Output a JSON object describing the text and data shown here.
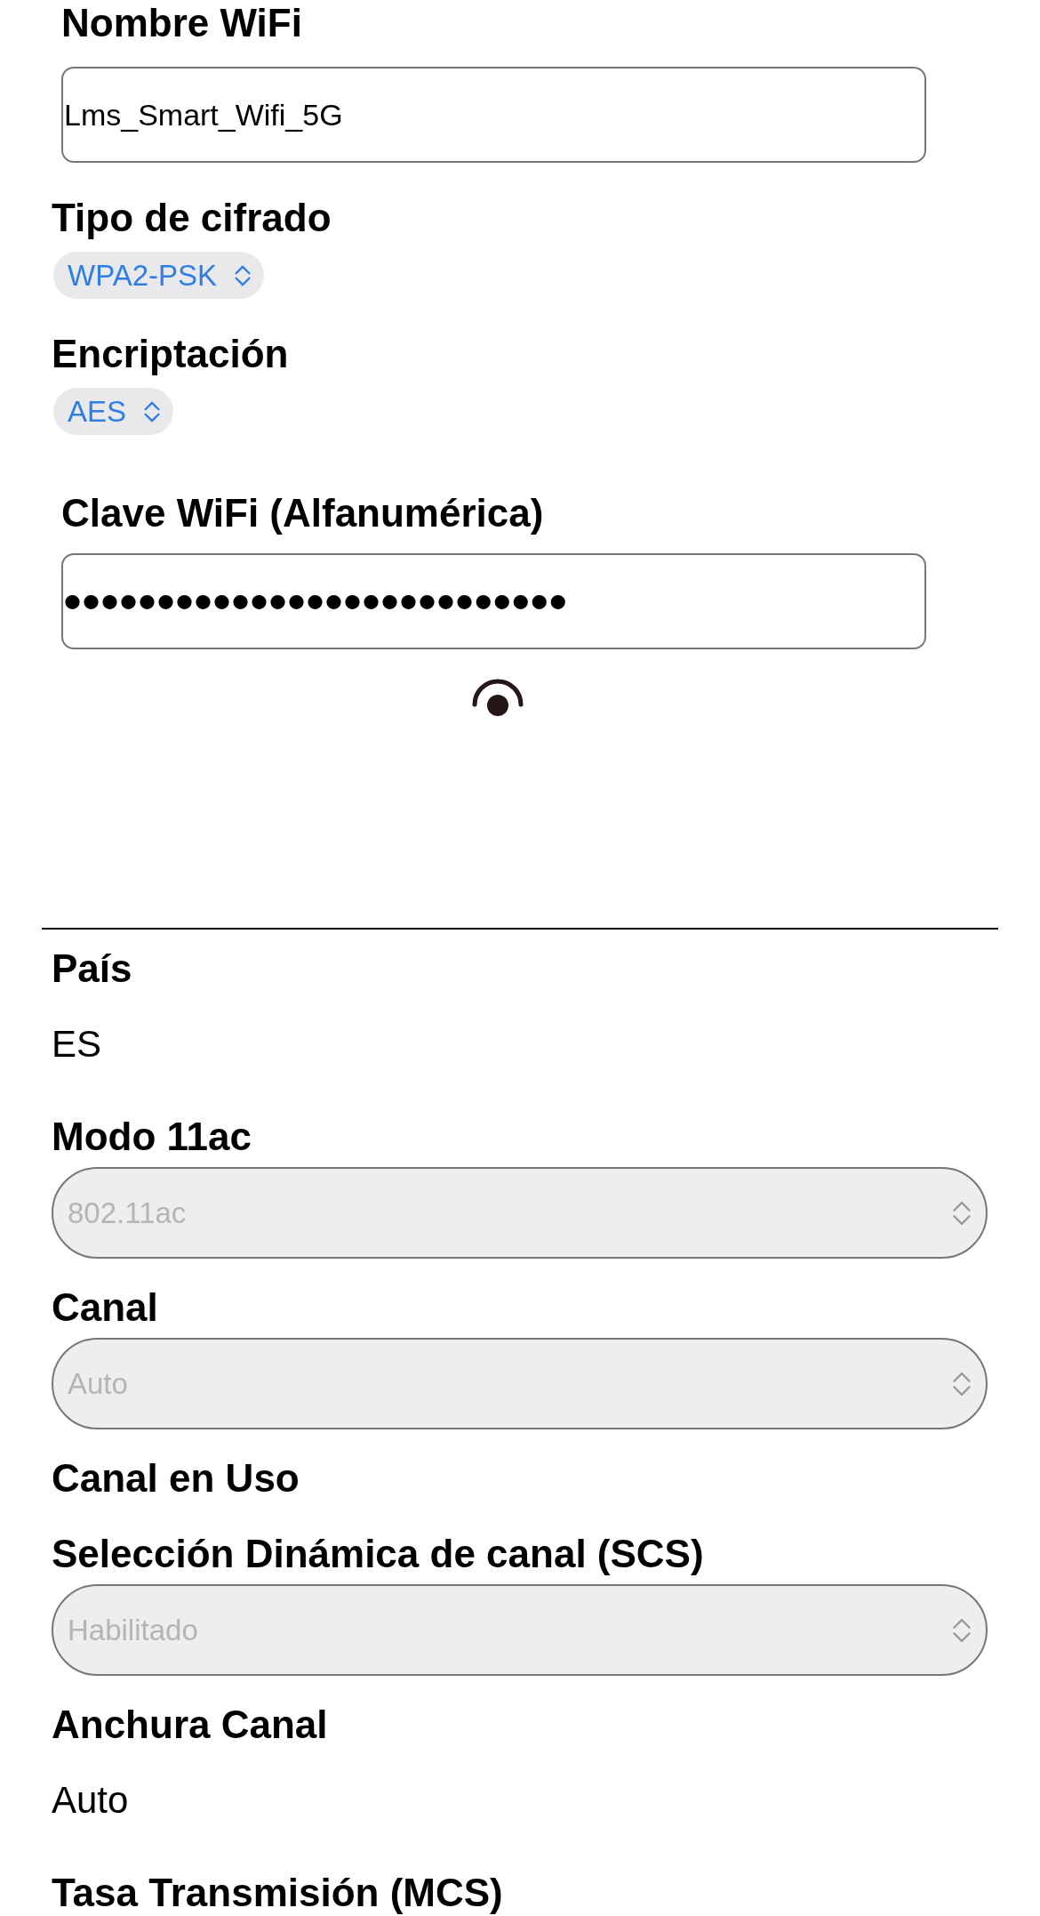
{
  "wifi": {
    "fields": [
      {
        "kind": "text_input",
        "label": "Nombre WiFi",
        "value": "Lms_Smart_Wifi_5G"
      },
      {
        "kind": "inline_select",
        "label": "Tipo de cifrado",
        "value": "WPA2-PSK"
      },
      {
        "kind": "inline_select",
        "label": "Encriptación",
        "value": "AES"
      },
      {
        "kind": "password_input",
        "label": "Clave WiFi (Alfanumérica)",
        "value": "•••••••••••••••••••••••••••"
      }
    ]
  },
  "radio": {
    "fields": [
      {
        "kind": "static",
        "label": "País",
        "value": "ES"
      },
      {
        "kind": "select",
        "label": "Modo 11ac",
        "value": "802.11ac",
        "disabled": true
      },
      {
        "kind": "select",
        "label": "Canal",
        "value": "Auto",
        "disabled": true
      },
      {
        "kind": "static",
        "label": "Canal en Uso"
      },
      {
        "kind": "select",
        "label": "Selección Dinámica de canal (SCS)",
        "value": "Habilitado",
        "disabled": true
      },
      {
        "kind": "static",
        "label": "Anchura Canal",
        "value": "Auto"
      },
      {
        "kind": "static",
        "label": "Tasa Transmisión (MCS)"
      }
    ]
  }
}
